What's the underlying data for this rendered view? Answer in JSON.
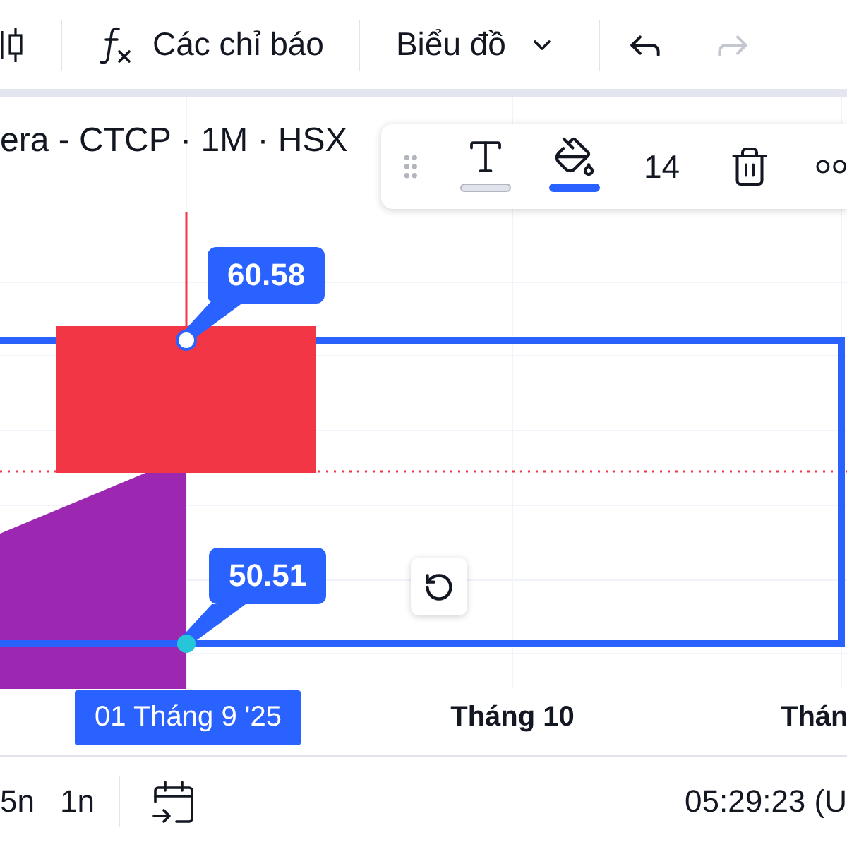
{
  "toolbar": {
    "indicators": "Các chỉ báo",
    "chart_type": "Biểu đồ",
    "history": [
      {
        "kind": "undo",
        "disabled": false
      },
      {
        "kind": "redo",
        "disabled": true
      }
    ]
  },
  "legend": "era - CTCP · 1M · HSX",
  "drawing_toolbar": {
    "swatches": [
      {
        "kind": "text",
        "color": "#e0e3eb"
      },
      {
        "kind": "fill",
        "color": "#2962ff"
      }
    ],
    "font_size": "14"
  },
  "price_labels": [
    "60.58",
    "50.51"
  ],
  "x_axis": [
    {
      "text": "01 Tháng 9 '25",
      "highlighted": true
    },
    {
      "text": "Tháng 10",
      "highlighted": false
    },
    {
      "text": "Thán",
      "highlighted": false
    }
  ],
  "bottom_bar": {
    "ranges": [
      "5n",
      "1n"
    ],
    "time": "05:29:23 (U"
  }
}
